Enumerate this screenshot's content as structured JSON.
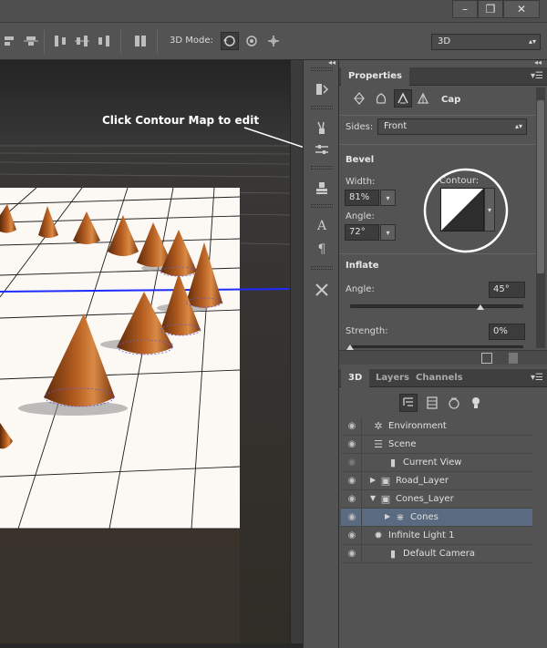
{
  "window": {
    "minimize_glyph": "–",
    "restore_glyph": "❐",
    "close_glyph": "✕"
  },
  "options_bar": {
    "mode_label": "3D Mode:",
    "workspace_select": "3D",
    "align_icons": [
      "align-left-edges-icon",
      "align-horizontal-centers-icon",
      "align-right-edges-icon",
      "distribute-left-icon",
      "distribute-centers-icon",
      "distribute-right-icon",
      "auto-align-icon"
    ],
    "mode_icons": [
      "rotate-3d-icon",
      "roll-3d-icon",
      "drag-3d-icon"
    ]
  },
  "annotation": {
    "text": "Click Contour Map to edit"
  },
  "properties_panel": {
    "tab": "Properties",
    "collapse_glyph": "◂◂",
    "menu_glyph": "▾☰",
    "mode_icons": [
      "mesh-icon",
      "deform-icon",
      "cap-icon"
    ],
    "mode_label": "Cap",
    "sides_label": "Sides:",
    "sides_value": "Front",
    "bevel_header": "Bevel",
    "width_label": "Width:",
    "width_value": "81%",
    "angle_label": "Angle:",
    "angle_value": "72°",
    "contour_label": "Contour:",
    "inflate_header": "Inflate",
    "inflate_angle_label": "Angle:",
    "inflate_angle_value": "45°",
    "inflate_angle_slider_fraction": 0.75,
    "strength_label": "Strength:",
    "strength_value": "0%",
    "strength_slider_fraction": 0.0
  },
  "layers_panel": {
    "tabs": [
      "3D",
      "Layers",
      "Channels"
    ],
    "active_tab": "3D",
    "filter_icons": [
      "scene-filter-icon",
      "mesh-filter-icon",
      "material-filter-icon",
      "light-filter-icon"
    ],
    "items": [
      {
        "name": "Environment",
        "icon": "environment-icon",
        "visible": true,
        "expand": "",
        "selected": false
      },
      {
        "name": "Scene",
        "icon": "scene-icon",
        "visible": true,
        "expand": "",
        "selected": false
      },
      {
        "name": "Current View",
        "icon": "camera-icon",
        "visible": false,
        "expand": "",
        "selected": false
      },
      {
        "name": "Road_Layer",
        "icon": "folder-icon",
        "visible": true,
        "expand": "▶",
        "selected": false
      },
      {
        "name": "Cones_Layer",
        "icon": "folder-icon",
        "visible": true,
        "expand": "▼",
        "selected": false
      },
      {
        "name": "Cones",
        "icon": "mesh-icon",
        "visible": true,
        "expand": "▶",
        "selected": true
      },
      {
        "name": "Infinite Light 1",
        "icon": "light-icon",
        "visible": true,
        "expand": "",
        "selected": false
      },
      {
        "name": "Default Camera",
        "icon": "camera-icon",
        "visible": true,
        "expand": "",
        "selected": false
      }
    ]
  },
  "colors": {
    "accent_blue_axis": "#1e2bff",
    "cone": "#a8521a",
    "selection_row": "#5a6a80"
  }
}
